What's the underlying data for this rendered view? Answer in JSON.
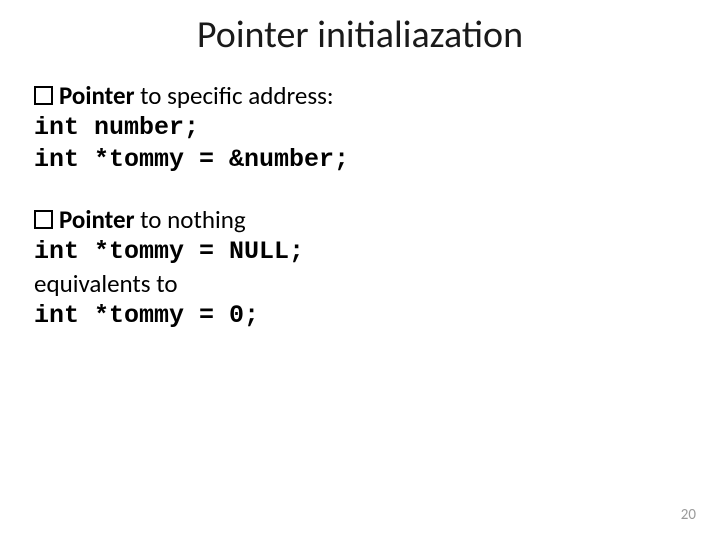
{
  "title": "Pointer initialiazation",
  "section1": {
    "bullet_bold": "Pointer",
    "bullet_rest": " to specific address:",
    "code1": "int number;",
    "code2": "int *tommy = &number;"
  },
  "section2": {
    "bullet_bold": "Pointer",
    "bullet_rest": " to nothing",
    "code1": "int *tommy = NULL;",
    "equiv": "equivalents to",
    "code2": "int *tommy = 0;"
  },
  "page_number": "20"
}
